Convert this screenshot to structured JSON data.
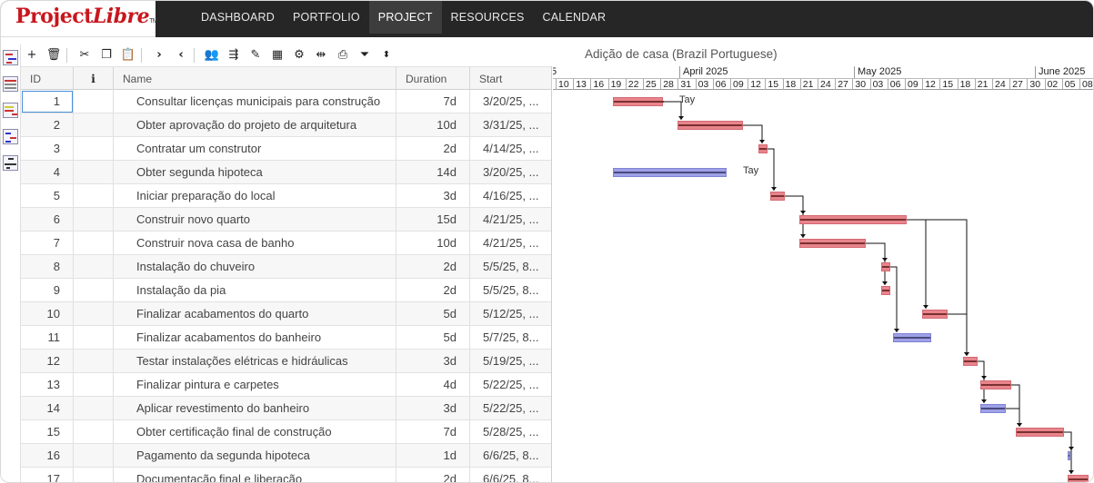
{
  "app": {
    "logo_main": "Project",
    "logo_libre": "Libre",
    "logo_tm": "TM"
  },
  "nav": {
    "items": [
      "DASHBOARD",
      "PORTFOLIO",
      "PROJECT",
      "RESOURCES",
      "CALENDAR"
    ],
    "active": "PROJECT"
  },
  "toolbar": {
    "project_title": "Adição de casa (Brazil Portuguese)",
    "icons": [
      "add-icon",
      "delete-icon",
      "cut-icon",
      "copy-icon",
      "paste-icon",
      "indent-icon",
      "outdent-icon",
      "assign-resources-icon",
      "link-icon",
      "notes-icon",
      "calendar-icon",
      "settings-icon",
      "split-icon",
      "print-icon",
      "filter-icon",
      "sort-icon"
    ]
  },
  "left_strip": {
    "icons": [
      "gantt-view-icon",
      "task-usage-view-icon",
      "resource-view-icon",
      "network-view-icon",
      "wbs-view-icon"
    ]
  },
  "grid": {
    "headers": {
      "id": "ID",
      "info": "i",
      "name": "Name",
      "duration": "Duration",
      "start": "Start"
    },
    "rows": [
      {
        "id": "1",
        "name": "Consultar licenças municipais para construção",
        "duration": "7d",
        "start": "3/20/25, ..."
      },
      {
        "id": "2",
        "name": "Obter aprovação do projeto de arquitetura",
        "duration": "10d",
        "start": "3/31/25, ..."
      },
      {
        "id": "3",
        "name": "Contratar um construtor",
        "duration": "2d",
        "start": "4/14/25, ..."
      },
      {
        "id": "4",
        "name": "Obter segunda hipoteca",
        "duration": "14d",
        "start": "3/20/25, ..."
      },
      {
        "id": "5",
        "name": "Iniciar preparação do local",
        "duration": "3d",
        "start": "4/16/25, ..."
      },
      {
        "id": "6",
        "name": "Construir novo quarto",
        "duration": "15d",
        "start": "4/21/25, ..."
      },
      {
        "id": "7",
        "name": "Construir nova casa de banho",
        "duration": "10d",
        "start": "4/21/25, ..."
      },
      {
        "id": "8",
        "name": "Instalação do chuveiro",
        "duration": "2d",
        "start": "5/5/25, 8..."
      },
      {
        "id": "9",
        "name": "Instalação da pia",
        "duration": "2d",
        "start": "5/5/25, 8..."
      },
      {
        "id": "10",
        "name": "Finalizar acabamentos do quarto",
        "duration": "5d",
        "start": "5/12/25, ..."
      },
      {
        "id": "11",
        "name": "Finalizar acabamentos do banheiro",
        "duration": "5d",
        "start": "5/7/25, 8..."
      },
      {
        "id": "12",
        "name": "Testar instalações elétricas e hidráulicas",
        "duration": "3d",
        "start": "5/19/25, ..."
      },
      {
        "id": "13",
        "name": "Finalizar pintura e carpetes",
        "duration": "4d",
        "start": "5/22/25, ..."
      },
      {
        "id": "14",
        "name": "Aplicar revestimento do banheiro",
        "duration": "3d",
        "start": "5/22/25, ..."
      },
      {
        "id": "15",
        "name": "Obter certificação final de construção",
        "duration": "7d",
        "start": "5/28/25, ..."
      },
      {
        "id": "16",
        "name": "Pagamento da segunda hipoteca",
        "duration": "1d",
        "start": "6/6/25, 8..."
      },
      {
        "id": "17",
        "name": "Documentação final e liberação",
        "duration": "2d",
        "start": "6/6/25, 8..."
      }
    ]
  },
  "gantt": {
    "months": [
      {
        "label": "5"
      },
      {
        "label": "April 2025"
      },
      {
        "label": "May 2025"
      },
      {
        "label": "June 2025"
      }
    ],
    "days": [
      "10",
      "13",
      "16",
      "19",
      "22",
      "25",
      "28",
      "31",
      "03",
      "06",
      "09",
      "12",
      "15",
      "18",
      "21",
      "24",
      "27",
      "30",
      "03",
      "06",
      "09",
      "12",
      "15",
      "18",
      "21",
      "24",
      "27",
      "30",
      "02",
      "05",
      "08"
    ],
    "colors": {
      "critical": "#e8848c",
      "normal": "#9ea0e8"
    },
    "bars": [
      {
        "row": 1,
        "kind": "red",
        "label": "Tay"
      },
      {
        "row": 2,
        "kind": "red",
        "label": ""
      },
      {
        "row": 3,
        "kind": "red",
        "label": ""
      },
      {
        "row": 4,
        "kind": "blue",
        "label": "Tay"
      },
      {
        "row": 5,
        "kind": "red",
        "label": ""
      },
      {
        "row": 6,
        "kind": "red",
        "label": ""
      },
      {
        "row": 7,
        "kind": "red",
        "label": ""
      },
      {
        "row": 8,
        "kind": "red",
        "label": ""
      },
      {
        "row": 9,
        "kind": "red",
        "label": ""
      },
      {
        "row": 10,
        "kind": "red",
        "label": ""
      },
      {
        "row": 11,
        "kind": "blue",
        "label": ""
      },
      {
        "row": 12,
        "kind": "red",
        "label": ""
      },
      {
        "row": 13,
        "kind": "red",
        "label": ""
      },
      {
        "row": 14,
        "kind": "blue",
        "label": ""
      },
      {
        "row": 15,
        "kind": "red",
        "label": ""
      },
      {
        "row": 16,
        "kind": "blue",
        "label": ""
      },
      {
        "row": 17,
        "kind": "red",
        "label": ""
      }
    ]
  }
}
